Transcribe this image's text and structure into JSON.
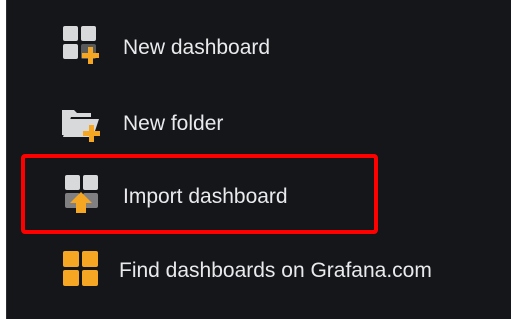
{
  "menu": {
    "items": [
      {
        "label": "New dashboard",
        "icon": "dashboard-add-icon"
      },
      {
        "label": "New folder",
        "icon": "folder-add-icon"
      },
      {
        "label": "Import dashboard",
        "icon": "dashboard-import-icon"
      },
      {
        "label": "Find dashboards on Grafana.com",
        "icon": "grafana-grid-icon"
      }
    ],
    "highlighted_item": "Import dashboard"
  },
  "colors": {
    "background": "#141619",
    "text": "#e9eaec",
    "icon_gray": "#d8d9da",
    "accent_orange": "#f5a623",
    "highlight_red": "#ff0000"
  }
}
